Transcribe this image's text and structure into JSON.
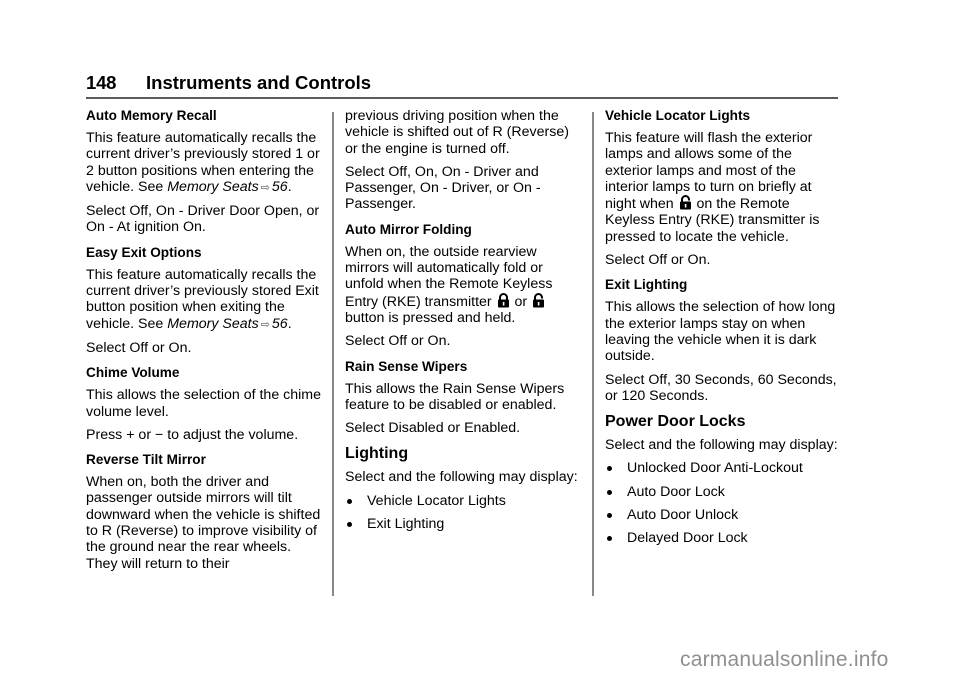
{
  "header": {
    "page_number": "148",
    "section_title": "Instruments and Controls"
  },
  "column1": {
    "auto_memory_recall": {
      "heading": "Auto Memory Recall",
      "body_prefix": "This feature automatically recalls the current driver’s previously stored 1 or 2 button positions when entering the vehicle. See ",
      "ref_text": "Memory Seats",
      "ref_arrow": "⇨",
      "ref_page": "56",
      "body_suffix": ".",
      "options": "Select Off, On - Driver Door Open, or On - At ignition On."
    },
    "easy_exit_options": {
      "heading": "Easy Exit Options",
      "body_prefix": "This feature automatically recalls the current driver’s previously stored Exit button position when exiting the vehicle. See ",
      "ref_text": "Memory Seats",
      "ref_arrow": "⇨",
      "ref_page": "56",
      "body_suffix": ".",
      "options": "Select Off or On."
    },
    "chime_volume": {
      "heading": "Chime Volume",
      "body": "This allows the selection of the chime volume level.",
      "instruction": "Press + or − to adjust the volume."
    },
    "reverse_tilt_mirror": {
      "heading": "Reverse Tilt Mirror",
      "body": "When on, both the driver and passenger outside mirrors will tilt downward when the vehicle is shifted to R (Reverse) to improve visibility of the ground near the rear wheels. They will return to their"
    }
  },
  "column2": {
    "reverse_tilt_mirror_cont": {
      "body": "previous driving position when the vehicle is shifted out of R (Reverse) or the engine is turned off.",
      "options": "Select Off, On, On - Driver and Passenger, On - Driver, or On - Passenger."
    },
    "auto_mirror_folding": {
      "heading": "Auto Mirror Folding",
      "body_prefix": "When on, the outside rearview mirrors will automatically fold or unfold when the Remote Keyless Entry (RKE) transmitter ",
      "icon_1": "lock-icon",
      "conjunction": " or ",
      "icon_2": "unlock-icon",
      "body_suffix": " button is pressed and held.",
      "options": "Select Off or On."
    },
    "rain_sense_wipers": {
      "heading": "Rain Sense Wipers",
      "body": "This allows the Rain Sense Wipers feature to be disabled or enabled.",
      "options": "Select Disabled or Enabled."
    },
    "lighting": {
      "heading": "Lighting",
      "intro": "Select and the following may display:",
      "items": [
        "Vehicle Locator Lights",
        "Exit Lighting"
      ]
    }
  },
  "column3": {
    "vehicle_locator_lights": {
      "heading": "Vehicle Locator Lights",
      "body_prefix": "This feature will flash the exterior lamps and allows some of the exterior lamps and most of the interior lamps to turn on briefly at night when ",
      "icon": "lock-icon",
      "body_suffix": " on the Remote Keyless Entry (RKE) transmitter is pressed to locate the vehicle.",
      "options": "Select Off or On."
    },
    "exit_lighting": {
      "heading": "Exit Lighting",
      "body": "This allows the selection of how long the exterior lamps stay on when leaving the vehicle when it is dark outside.",
      "options": "Select Off, 30 Seconds, 60 Seconds, or 120 Seconds."
    },
    "power_door_locks": {
      "heading": "Power Door Locks",
      "intro": "Select and the following may display:",
      "items": [
        "Unlocked Door Anti-Lockout",
        "Auto Door Lock",
        "Auto Door Unlock",
        "Delayed Door Lock"
      ]
    }
  },
  "watermark": {
    "text": "carmanualsonline.info"
  }
}
